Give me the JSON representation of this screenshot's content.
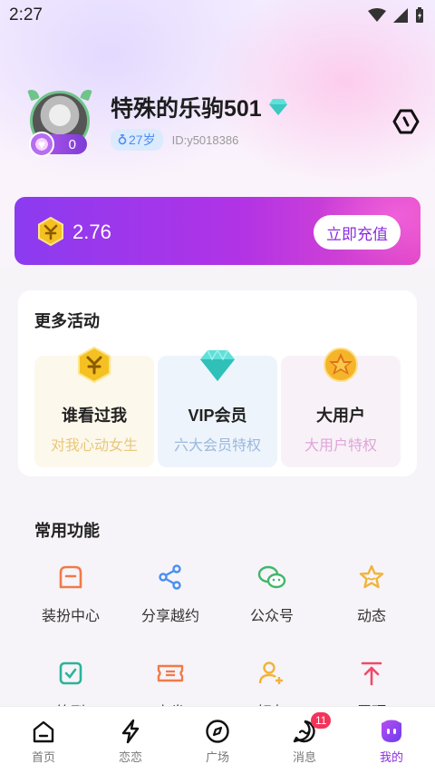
{
  "status_bar": {
    "time": "2:27"
  },
  "profile": {
    "nickname": "特殊的乐驹501",
    "level": "0",
    "age": "27岁",
    "user_id": "ID:y5018386"
  },
  "wallet": {
    "balance": "2.76",
    "recharge_label": "立即充值"
  },
  "activities": {
    "title": "更多活动",
    "items": [
      {
        "title": "谁看过我",
        "subtitle": "对我心动女生",
        "icon": "coin-hexagon-icon",
        "bg": "#fdf8ec",
        "sub_color": "#e8c77c"
      },
      {
        "title": "VIP会员",
        "subtitle": "六大会员特权",
        "icon": "diamond-icon",
        "bg": "#eef4fc",
        "sub_color": "#9ab8dc"
      },
      {
        "title": "大用户",
        "subtitle": "大用户特权",
        "icon": "star-medal-icon",
        "bg": "#f8f2f8",
        "sub_color": "#e0a4d8"
      }
    ]
  },
  "functions": {
    "title": "常用功能",
    "items": [
      {
        "label": "装扮中心",
        "icon": "wardrobe-icon",
        "color": "#f07a4a"
      },
      {
        "label": "分享越约",
        "icon": "share-icon",
        "color": "#4a8ef2"
      },
      {
        "label": "公众号",
        "icon": "wechat-icon",
        "color": "#3fb86a"
      },
      {
        "label": "动态",
        "icon": "star-icon",
        "color": "#f2b33a"
      },
      {
        "label": "签到",
        "icon": "checkin-icon",
        "color": "#2cb39a"
      },
      {
        "label": "卡券",
        "icon": "coupon-icon",
        "color": "#f07a4a"
      },
      {
        "label": "好友",
        "icon": "add-friend-icon",
        "color": "#f2b33a"
      },
      {
        "label": "置顶",
        "icon": "pin-top-icon",
        "color": "#f04a6a"
      }
    ]
  },
  "tabbar": {
    "items": [
      {
        "label": "首页",
        "icon": "home-icon"
      },
      {
        "label": "恋恋",
        "icon": "lightning-icon"
      },
      {
        "label": "广场",
        "icon": "compass-icon"
      },
      {
        "label": "消息",
        "icon": "message-icon",
        "badge": "11"
      },
      {
        "label": "我的",
        "icon": "me-icon",
        "active": true
      }
    ]
  },
  "colors": {
    "accent": "#8a2ee0",
    "badge": "#f4335b"
  }
}
